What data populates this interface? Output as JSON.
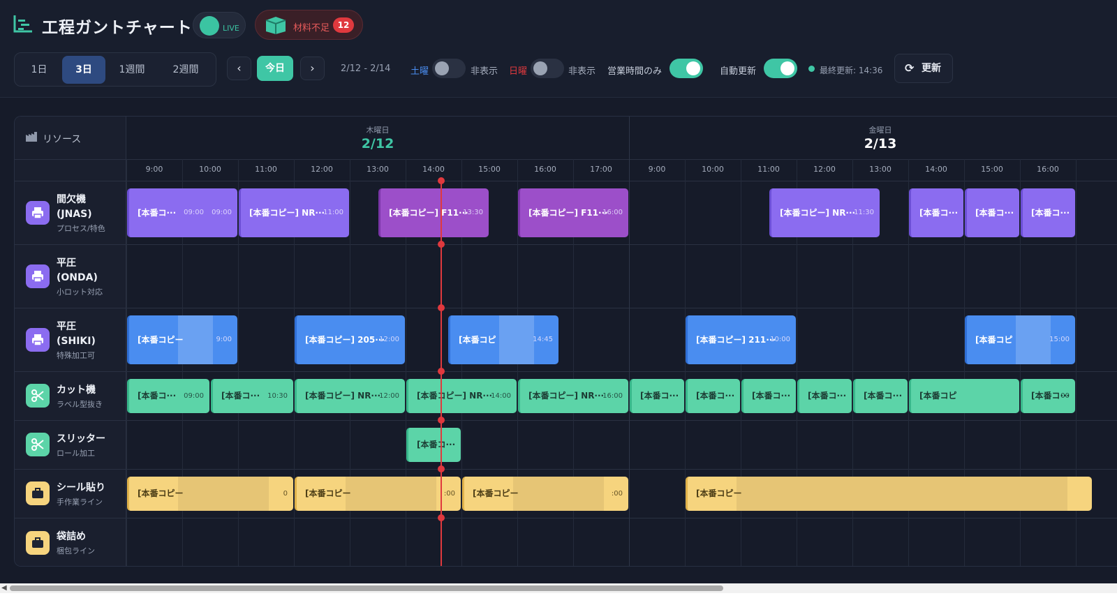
{
  "app": {
    "title": "工程ガントチャート",
    "live_label": "LIVE"
  },
  "shortage": {
    "label": "材料不足",
    "count": "12"
  },
  "range_buttons": [
    {
      "label": "1日",
      "active": false
    },
    {
      "label": "3日",
      "active": true
    },
    {
      "label": "1週間",
      "active": false
    },
    {
      "label": "2週間",
      "active": false
    }
  ],
  "nav": {
    "prev": "‹",
    "today": "今日",
    "next": "›",
    "date_range": "2/12 - 2/14"
  },
  "filters": {
    "saturday": "土曜",
    "saturday_state": "非表示",
    "sunday": "日曜",
    "sunday_state": "非表示",
    "business_hours": "営業時間のみ",
    "auto_refresh": "自動更新",
    "last_updated": "最終更新: 14:36",
    "refresh": "更新"
  },
  "colors": {
    "accent": "#3fc6a5",
    "alert": "#e0393e",
    "active_range": "#2e4a80"
  },
  "gantt": {
    "resource_header": "リソース",
    "days": [
      {
        "weekday": "木曜日",
        "date": "2/12",
        "color": "#3fc6a5"
      },
      {
        "weekday": "金曜日",
        "date": "2/13",
        "color": "#ffffff"
      }
    ],
    "hours": [
      "9:00",
      "10:00",
      "11:00",
      "12:00",
      "13:00",
      "14:00",
      "15:00",
      "16:00",
      "17:00",
      "9:00",
      "10:00",
      "11:00",
      "12:00",
      "13:00",
      "14:00",
      "15:00",
      "16:00"
    ],
    "resources": [
      {
        "name": "間欠機\n(JNAS)",
        "sub": "プロセス/特色",
        "icon": "printer-icon",
        "color": "#8b6cf0"
      },
      {
        "name": "平圧\n(ONDA)",
        "sub": "小ロット対応",
        "icon": "printer-icon",
        "color": "#8b6cf0"
      },
      {
        "name": "平圧\n(SHIKI)",
        "sub": "特殊加工可",
        "icon": "printer-icon",
        "color": "#8b6cf0"
      },
      {
        "name": "カット機",
        "sub": "ラベル型抜き",
        "icon": "scissors-icon",
        "color": "#5cd4a8"
      },
      {
        "name": "スリッター",
        "sub": "ロール加工",
        "icon": "scissors-icon",
        "color": "#5cd4a8"
      },
      {
        "name": "シール貼り",
        "sub": "手作業ライン",
        "icon": "briefcase-icon",
        "color": "#f6d47e"
      },
      {
        "name": "袋詰め",
        "sub": "梱包ライン",
        "icon": "briefcase-icon",
        "color": "#f6d47e"
      }
    ],
    "tasks": [
      {
        "row": 0,
        "start": 0,
        "span": 2,
        "color": "violet",
        "label": "[本番コ···",
        "time": "09:00",
        "time2": "09:00"
      },
      {
        "row": 0,
        "start": 2,
        "span": 2,
        "color": "violet",
        "label": "[本番コピー] NR···",
        "time": "11:00"
      },
      {
        "row": 0,
        "start": 4.5,
        "span": 2,
        "color": "purple",
        "label": "[本番コピー] F11···",
        "time": "13:30"
      },
      {
        "row": 0,
        "start": 7,
        "span": 2,
        "color": "purple",
        "label": "[本番コピー] F11···",
        "time": "16:00"
      },
      {
        "row": 0,
        "start": 11.5,
        "span": 2,
        "color": "violet",
        "label": "[本番コピー] NR···",
        "time": "11:30"
      },
      {
        "row": 0,
        "start": 14,
        "span": 1,
        "color": "violet",
        "label": "[本番コ···",
        "time": ""
      },
      {
        "row": 0,
        "start": 15,
        "span": 1,
        "color": "violet",
        "label": "[本番コ···",
        "time": ""
      },
      {
        "row": 0,
        "start": 16,
        "span": 1,
        "color": "violet",
        "label": "[本番コ···",
        "time": ""
      },
      {
        "row": 2,
        "start": 0,
        "span": 2,
        "color": "blue",
        "label": "[本番コピー",
        "time": "9:00"
      },
      {
        "row": 2,
        "start": 3,
        "span": 2,
        "color": "blue",
        "label": "[本番コピー] 205···",
        "time": "12:00"
      },
      {
        "row": 2,
        "start": 5.75,
        "span": 2,
        "color": "blue",
        "label": "[本番コピ",
        "time": "14:45"
      },
      {
        "row": 2,
        "start": 10,
        "span": 2,
        "color": "blue",
        "label": "[本番コピー] 211···",
        "time": "10:00"
      },
      {
        "row": 2,
        "start": 15,
        "span": 2,
        "color": "blue",
        "label": "[本番コピ",
        "time": "15:00"
      },
      {
        "row": 3,
        "start": 0,
        "span": 1.5,
        "color": "green",
        "label": "[本番コ···",
        "time": "09:00"
      },
      {
        "row": 3,
        "start": 1.5,
        "span": 1.5,
        "color": "green",
        "label": "[本番コ···",
        "time": "10:30"
      },
      {
        "row": 3,
        "start": 3,
        "span": 2,
        "color": "green",
        "label": "[本番コピー] NR···",
        "time": "12:00"
      },
      {
        "row": 3,
        "start": 5,
        "span": 2,
        "color": "green",
        "label": "[本番コピー] NR···",
        "time": "14:00"
      },
      {
        "row": 3,
        "start": 7,
        "span": 2,
        "color": "green",
        "label": "[本番コピー] NR···",
        "time": "16:00"
      },
      {
        "row": 3,
        "start": 9,
        "span": 1,
        "color": "green",
        "label": "[本番コ···",
        "time": ""
      },
      {
        "row": 3,
        "start": 10,
        "span": 1,
        "color": "green",
        "label": "[本番コ···",
        "time": ""
      },
      {
        "row": 3,
        "start": 11,
        "span": 1,
        "color": "green",
        "label": "[本番コ···",
        "time": ""
      },
      {
        "row": 3,
        "start": 12,
        "span": 1,
        "color": "green",
        "label": "[本番コ···",
        "time": ""
      },
      {
        "row": 3,
        "start": 13,
        "span": 1,
        "color": "green",
        "label": "[本番コ···",
        "time": ""
      },
      {
        "row": 3,
        "start": 14,
        "span": 2,
        "color": "green",
        "label": "[本番コピ",
        "time": ""
      },
      {
        "row": 3,
        "start": 16,
        "span": 1,
        "color": "green",
        "label": "[本番コ···",
        "time": "00"
      },
      {
        "row": 4,
        "start": 5,
        "span": 1,
        "color": "green",
        "label": "[本番コ···",
        "time": ""
      },
      {
        "row": 5,
        "start": 0,
        "span": 3,
        "color": "yellow",
        "label": "[本番コピー",
        "time": "0"
      },
      {
        "row": 5,
        "start": 3,
        "span": 3,
        "color": "yellow",
        "label": "[本番コピー",
        "time": ":00"
      },
      {
        "row": 5,
        "start": 6,
        "span": 3,
        "color": "yellow",
        "label": "[本番コピー",
        "time": ":00"
      },
      {
        "row": 5,
        "start": 10,
        "span": 7.3,
        "color": "yellow",
        "label": "[本番コピー",
        "time": ""
      }
    ]
  }
}
